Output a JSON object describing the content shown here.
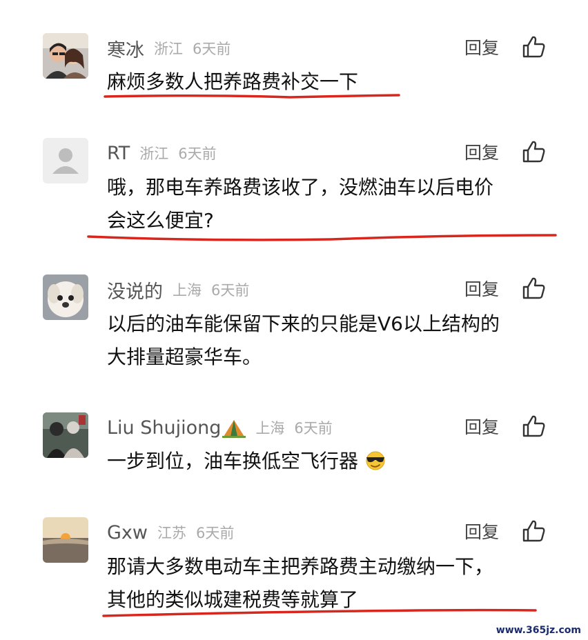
{
  "comments": [
    {
      "username": "寒冰",
      "location": "浙江",
      "time": "6天前",
      "reply_label": "回复",
      "lines": [
        "麻烦多数人把养路费补交一下"
      ]
    },
    {
      "username": "RT",
      "location": "浙江",
      "time": "6天前",
      "reply_label": "回复",
      "lines": [
        "哦，那电车养路费该收了，没燃油车以后电价",
        "会这么便宜?"
      ]
    },
    {
      "username": "没说的",
      "location": "上海",
      "time": "6天前",
      "reply_label": "回复",
      "lines": [
        "以后的油车能保留下来的只能是V6以上结构的",
        "大排量超豪华车。"
      ]
    },
    {
      "username": "Liu Shujiong",
      "location": "上海",
      "time": "6天前",
      "reply_label": "回复",
      "lines": [
        "一步到位，油车换低空飞行器"
      ]
    },
    {
      "username": "Gxw",
      "location": "江苏",
      "time": "6天前",
      "reply_label": "回复",
      "lines": [
        "那请大多数电动车主把养路费主动缴纳一下，",
        "其他的类似城建税费等就算了"
      ]
    }
  ],
  "watermark": "www.365jz.com",
  "colors": {
    "underline": "#d9261c",
    "meta": "#aaaaaa",
    "username": "#555555"
  },
  "icons": {
    "like": "thumbs-up-icon",
    "emoji": "cool-sunglasses-emoji-icon"
  }
}
